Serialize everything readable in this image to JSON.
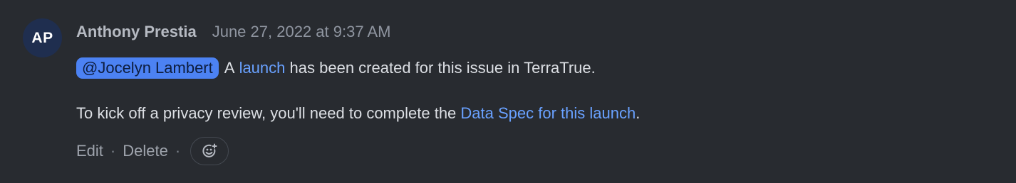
{
  "comment": {
    "avatar_initials": "AP",
    "author": "Anthony Prestia",
    "timestamp": "June 27, 2022 at 9:37 AM",
    "line1": {
      "mention": "@Jocelyn Lambert",
      "text_before_link": "A",
      "link": "launch",
      "text_after_link": "has been created for this issue in TerraTrue."
    },
    "line2": {
      "text_before_link": "To kick off a privacy review, you'll need to complete the",
      "link": "Data Spec for this launch",
      "text_after_link": "."
    }
  },
  "actions": {
    "edit_label": "Edit",
    "delete_label": "Delete",
    "separator": "·",
    "reaction_icon": "smiley-add-icon"
  },
  "colors": {
    "background": "#282b30",
    "avatar_bg": "#1f2e4f",
    "mention_bg": "#4c82f3",
    "link": "#69a1ff"
  }
}
